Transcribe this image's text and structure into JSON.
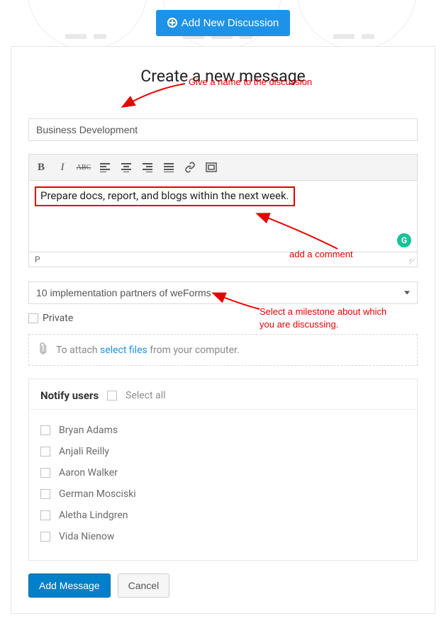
{
  "header": {
    "add_button_label": "Add New Discussion"
  },
  "page_title": "Create a new message",
  "title_input": {
    "value": "Business Development"
  },
  "editor": {
    "content": "Prepare docs, report, and blogs within the next week.",
    "path_label": "P",
    "grammarly_label": "G"
  },
  "toolbar_icons": [
    "bold",
    "italic",
    "strikethrough",
    "align-left",
    "align-center",
    "align-right",
    "align-justify",
    "link",
    "fullscreen"
  ],
  "milestone_select": {
    "selected": "10 implementation partners of weForms"
  },
  "private_label": "Private",
  "attach": {
    "prefix": "To attach ",
    "link": "select files",
    "suffix": " from your computer."
  },
  "notify": {
    "title": "Notify users",
    "select_all_label": "Select all",
    "users": [
      "Bryan Adams",
      "Anjali Reilly",
      "Aaron Walker",
      "German Mosciski",
      "Aletha Lindgren",
      "Vida Nienow"
    ]
  },
  "buttons": {
    "submit": "Add Message",
    "cancel": "Cancel"
  },
  "annotations": {
    "a1": "Give a name to the discussion",
    "a2": "add a comment",
    "a3_line1": "Select a milestone about which",
    "a3_line2": "you are discussing."
  }
}
